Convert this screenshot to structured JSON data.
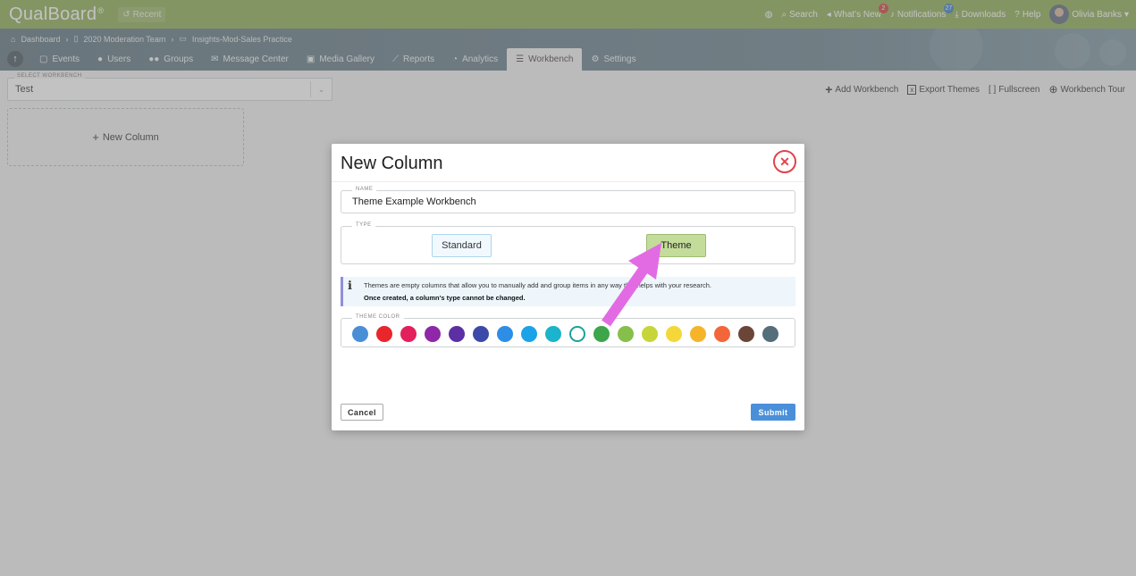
{
  "app": {
    "brand": "QualBoard",
    "brand_mark": "®",
    "recent_label": "Recent"
  },
  "topbar": {
    "items": [
      {
        "icon": "globe-icon",
        "label": ""
      },
      {
        "icon": "search-icon",
        "label": "Search"
      },
      {
        "icon": "megaphone-icon",
        "label": "What's New",
        "badge": "2"
      },
      {
        "icon": "bell-icon",
        "label": "Notifications",
        "badge": "27"
      },
      {
        "icon": "download-icon",
        "label": "Downloads"
      },
      {
        "icon": "help-icon",
        "label": "Help"
      }
    ],
    "user_name": "Olivia Banks"
  },
  "breadcrumb": [
    "Dashboard",
    "2020 Moderation Team",
    "Insights-Mod-Sales Practice"
  ],
  "tabs": [
    {
      "label": "Events",
      "icon": "calendar-icon"
    },
    {
      "label": "Users",
      "icon": "user-icon"
    },
    {
      "label": "Groups",
      "icon": "users-icon"
    },
    {
      "label": "Message Center",
      "icon": "envelope-icon"
    },
    {
      "label": "Media Gallery",
      "icon": "gallery-icon"
    },
    {
      "label": "Reports",
      "icon": "chart-icon"
    },
    {
      "label": "Analytics",
      "icon": "pie-icon"
    },
    {
      "label": "Workbench",
      "icon": "columns-icon",
      "active": true
    },
    {
      "label": "Settings",
      "icon": "gear-icon"
    }
  ],
  "workbench": {
    "select_label": "SELECT WORKBENCH",
    "selected": "Test",
    "actions": [
      {
        "icon": "plus-icon",
        "label": "Add Workbench"
      },
      {
        "icon": "excel-icon",
        "label": "Export Themes"
      },
      {
        "icon": "fullscreen-icon",
        "label": "Fullscreen"
      },
      {
        "icon": "lifebuoy-icon",
        "label": "Workbench Tour"
      }
    ],
    "new_column_label": "New Column"
  },
  "modal": {
    "title": "New Column",
    "name_label": "NAME",
    "name_value": "Theme Example Workbench",
    "type_label": "TYPE",
    "type_options": [
      "Standard",
      "Theme"
    ],
    "type_selected": "Theme",
    "info_line1": "Themes are empty columns that allow you to manually add and group items in any way that helps with your research.",
    "info_line2": "Once created, a column's type cannot be changed.",
    "color_label": "THEME COLOR",
    "colors": [
      "#4a8fd6",
      "#e8262b",
      "#e3205c",
      "#8e27a8",
      "#5c2fa5",
      "#3b4aa8",
      "#2d8ee6",
      "#1ba3e8",
      "#1cb3cc",
      "#ffffff",
      "#3da54a",
      "#86bf4b",
      "#c6d63a",
      "#f4d83a",
      "#f6b42b",
      "#f4663a",
      "#6b4638",
      "#546e7a"
    ],
    "selected_color_index": 9,
    "cancel_label": "Cancel",
    "submit_label": "Submit"
  }
}
